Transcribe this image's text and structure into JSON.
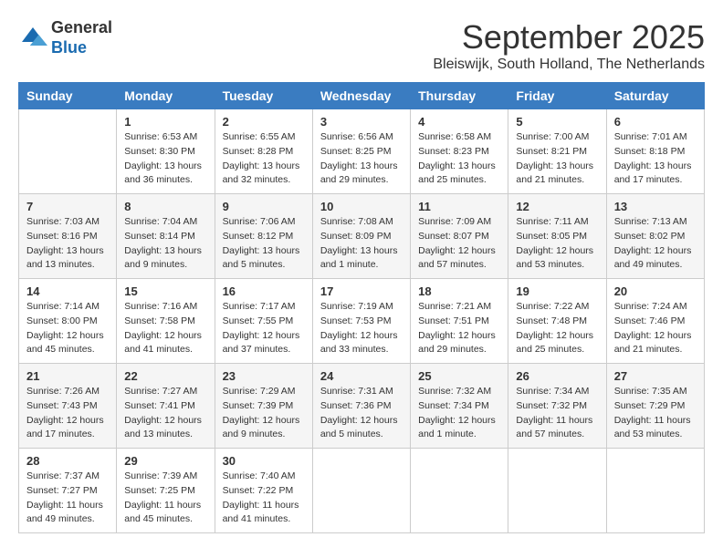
{
  "header": {
    "logo_general": "General",
    "logo_blue": "Blue",
    "month_title": "September 2025",
    "location": "Bleiswijk, South Holland, The Netherlands"
  },
  "weekdays": [
    "Sunday",
    "Monday",
    "Tuesday",
    "Wednesday",
    "Thursday",
    "Friday",
    "Saturday"
  ],
  "weeks": [
    [
      {
        "day": "",
        "info": ""
      },
      {
        "day": "1",
        "info": "Sunrise: 6:53 AM\nSunset: 8:30 PM\nDaylight: 13 hours\nand 36 minutes."
      },
      {
        "day": "2",
        "info": "Sunrise: 6:55 AM\nSunset: 8:28 PM\nDaylight: 13 hours\nand 32 minutes."
      },
      {
        "day": "3",
        "info": "Sunrise: 6:56 AM\nSunset: 8:25 PM\nDaylight: 13 hours\nand 29 minutes."
      },
      {
        "day": "4",
        "info": "Sunrise: 6:58 AM\nSunset: 8:23 PM\nDaylight: 13 hours\nand 25 minutes."
      },
      {
        "day": "5",
        "info": "Sunrise: 7:00 AM\nSunset: 8:21 PM\nDaylight: 13 hours\nand 21 minutes."
      },
      {
        "day": "6",
        "info": "Sunrise: 7:01 AM\nSunset: 8:18 PM\nDaylight: 13 hours\nand 17 minutes."
      }
    ],
    [
      {
        "day": "7",
        "info": "Sunrise: 7:03 AM\nSunset: 8:16 PM\nDaylight: 13 hours\nand 13 minutes."
      },
      {
        "day": "8",
        "info": "Sunrise: 7:04 AM\nSunset: 8:14 PM\nDaylight: 13 hours\nand 9 minutes."
      },
      {
        "day": "9",
        "info": "Sunrise: 7:06 AM\nSunset: 8:12 PM\nDaylight: 13 hours\nand 5 minutes."
      },
      {
        "day": "10",
        "info": "Sunrise: 7:08 AM\nSunset: 8:09 PM\nDaylight: 13 hours\nand 1 minute."
      },
      {
        "day": "11",
        "info": "Sunrise: 7:09 AM\nSunset: 8:07 PM\nDaylight: 12 hours\nand 57 minutes."
      },
      {
        "day": "12",
        "info": "Sunrise: 7:11 AM\nSunset: 8:05 PM\nDaylight: 12 hours\nand 53 minutes."
      },
      {
        "day": "13",
        "info": "Sunrise: 7:13 AM\nSunset: 8:02 PM\nDaylight: 12 hours\nand 49 minutes."
      }
    ],
    [
      {
        "day": "14",
        "info": "Sunrise: 7:14 AM\nSunset: 8:00 PM\nDaylight: 12 hours\nand 45 minutes."
      },
      {
        "day": "15",
        "info": "Sunrise: 7:16 AM\nSunset: 7:58 PM\nDaylight: 12 hours\nand 41 minutes."
      },
      {
        "day": "16",
        "info": "Sunrise: 7:17 AM\nSunset: 7:55 PM\nDaylight: 12 hours\nand 37 minutes."
      },
      {
        "day": "17",
        "info": "Sunrise: 7:19 AM\nSunset: 7:53 PM\nDaylight: 12 hours\nand 33 minutes."
      },
      {
        "day": "18",
        "info": "Sunrise: 7:21 AM\nSunset: 7:51 PM\nDaylight: 12 hours\nand 29 minutes."
      },
      {
        "day": "19",
        "info": "Sunrise: 7:22 AM\nSunset: 7:48 PM\nDaylight: 12 hours\nand 25 minutes."
      },
      {
        "day": "20",
        "info": "Sunrise: 7:24 AM\nSunset: 7:46 PM\nDaylight: 12 hours\nand 21 minutes."
      }
    ],
    [
      {
        "day": "21",
        "info": "Sunrise: 7:26 AM\nSunset: 7:43 PM\nDaylight: 12 hours\nand 17 minutes."
      },
      {
        "day": "22",
        "info": "Sunrise: 7:27 AM\nSunset: 7:41 PM\nDaylight: 12 hours\nand 13 minutes."
      },
      {
        "day": "23",
        "info": "Sunrise: 7:29 AM\nSunset: 7:39 PM\nDaylight: 12 hours\nand 9 minutes."
      },
      {
        "day": "24",
        "info": "Sunrise: 7:31 AM\nSunset: 7:36 PM\nDaylight: 12 hours\nand 5 minutes."
      },
      {
        "day": "25",
        "info": "Sunrise: 7:32 AM\nSunset: 7:34 PM\nDaylight: 12 hours\nand 1 minute."
      },
      {
        "day": "26",
        "info": "Sunrise: 7:34 AM\nSunset: 7:32 PM\nDaylight: 11 hours\nand 57 minutes."
      },
      {
        "day": "27",
        "info": "Sunrise: 7:35 AM\nSunset: 7:29 PM\nDaylight: 11 hours\nand 53 minutes."
      }
    ],
    [
      {
        "day": "28",
        "info": "Sunrise: 7:37 AM\nSunset: 7:27 PM\nDaylight: 11 hours\nand 49 minutes."
      },
      {
        "day": "29",
        "info": "Sunrise: 7:39 AM\nSunset: 7:25 PM\nDaylight: 11 hours\nand 45 minutes."
      },
      {
        "day": "30",
        "info": "Sunrise: 7:40 AM\nSunset: 7:22 PM\nDaylight: 11 hours\nand 41 minutes."
      },
      {
        "day": "",
        "info": ""
      },
      {
        "day": "",
        "info": ""
      },
      {
        "day": "",
        "info": ""
      },
      {
        "day": "",
        "info": ""
      }
    ]
  ]
}
